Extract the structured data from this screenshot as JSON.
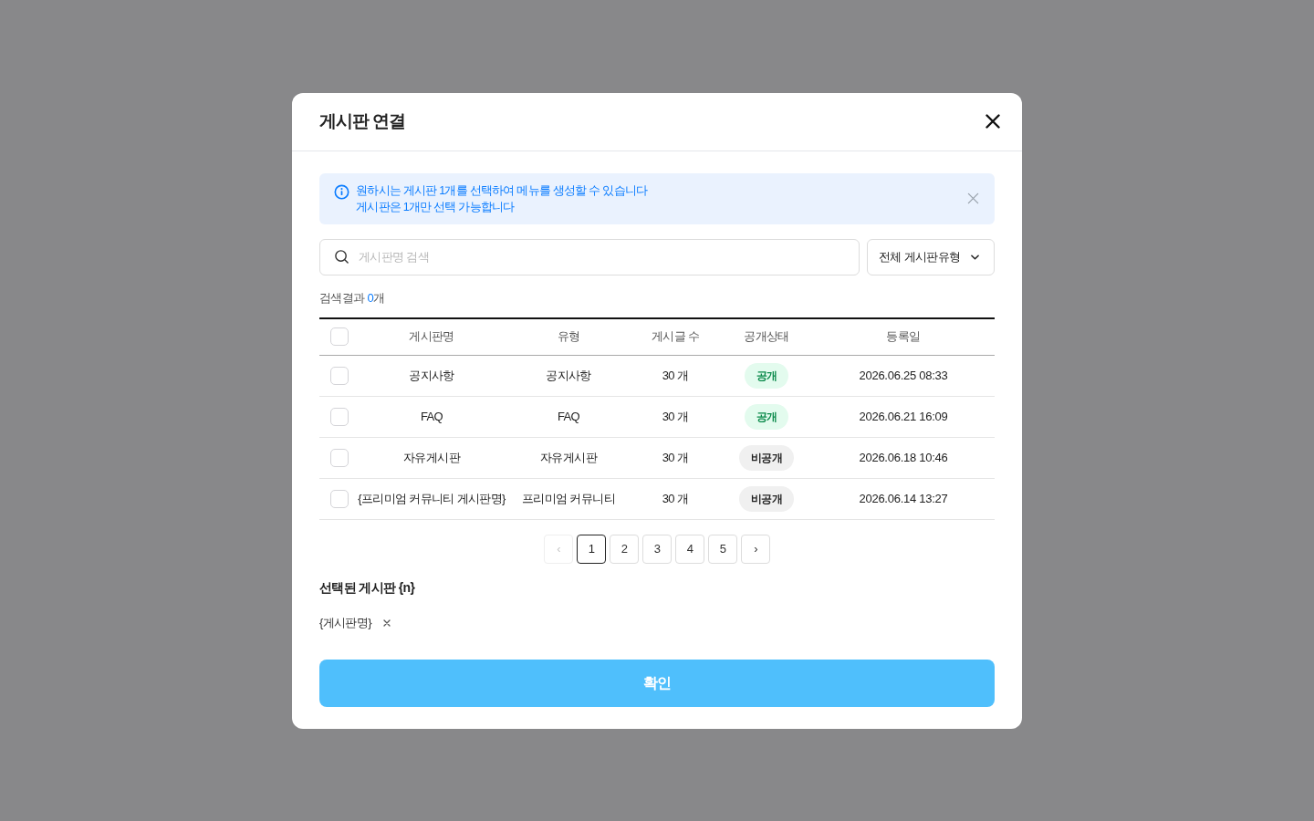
{
  "dialog": {
    "title": "게시판 연결"
  },
  "notice": {
    "lines": [
      "원하시는 게시판 1개를 선택하여 메뉴를 생성할 수 있습니다",
      "게시판은 1개만 선택 가능합니다"
    ]
  },
  "search": {
    "placeholder": "게시판명 검색"
  },
  "type_filter": {
    "value": "전체 게시판유형"
  },
  "result_summary": {
    "label": "검색결과",
    "count": "0",
    "unit": "개"
  },
  "table": {
    "select_all": {
      "checked": false
    },
    "columns": [
      "게시판명",
      "유형",
      "게시글 수",
      "공개상태",
      "등록일"
    ],
    "rows": [
      {
        "checked": false,
        "name": "공지사항",
        "type": "공지사항",
        "posts": "30 개",
        "status": {
          "kind": "public",
          "label": "공개"
        },
        "date": "2026.06.25 08:33"
      },
      {
        "checked": false,
        "name": "FAQ",
        "type": "FAQ",
        "posts": "30 개",
        "status": {
          "kind": "public",
          "label": "공개"
        },
        "date": "2026.06.21 16:09"
      },
      {
        "checked": false,
        "name": "자유게시판",
        "type": "자유게시판",
        "posts": "30 개",
        "status": {
          "kind": "private",
          "label": "비공개"
        },
        "date": "2026.06.18 10:46"
      },
      {
        "checked": false,
        "name": "{프리미엄 커뮤니티 게시판명}",
        "type": "프리미엄 커뮤니티",
        "posts": "30 개",
        "status": {
          "kind": "private",
          "label": "비공개"
        },
        "date": "2026.06.14 13:27"
      }
    ]
  },
  "pagination": {
    "prev": {
      "label": "‹",
      "disabled": true
    },
    "pages": [
      {
        "label": "1",
        "selected": true
      },
      {
        "label": "2",
        "selected": false
      },
      {
        "label": "3",
        "selected": false
      },
      {
        "label": "4",
        "selected": false
      },
      {
        "label": "5",
        "selected": false
      }
    ],
    "next": {
      "label": "›",
      "disabled": false
    }
  },
  "selected_boards": {
    "title": "선택된 게시판 {n}",
    "items": [
      {
        "label": "{게시판명}"
      }
    ]
  },
  "confirm_button": {
    "label": "확인"
  }
}
